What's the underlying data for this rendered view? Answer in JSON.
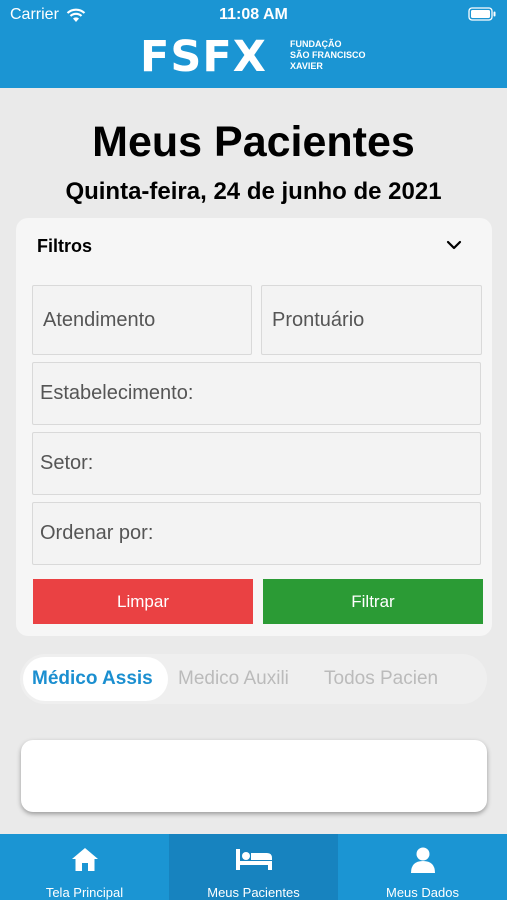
{
  "status_bar": {
    "carrier": "Carrier",
    "time": "11:08 AM"
  },
  "brand": {
    "mark": "FSFX",
    "sub_line1": "FUNDAÇÃO",
    "sub_line2": "SÃO FRANCISCO",
    "sub_line3": "XAVIER"
  },
  "page": {
    "title": "Meus Pacientes",
    "date": "Quinta-feira, 24 de junho de 2021"
  },
  "filters": {
    "title": "Filtros",
    "atendimento_placeholder": "Atendimento",
    "prontuario_placeholder": "Prontuário",
    "estabelecimento_label": "Estabelecimento:",
    "setor_label": "Setor:",
    "ordenar_label": "Ordenar por:",
    "clear_label": "Limpar",
    "filter_label": "Filtrar"
  },
  "segment_tabs": [
    {
      "label": "Médico Assis",
      "active": true
    },
    {
      "label": "Medico Auxili",
      "active": false
    },
    {
      "label": "Todos Pacien",
      "active": false
    }
  ],
  "tab_bar": [
    {
      "label": "Tela Principal",
      "icon": "home-icon",
      "active": false
    },
    {
      "label": "Meus Pacientes",
      "icon": "bed-icon",
      "active": true
    },
    {
      "label": "Meus Dados",
      "icon": "user-icon",
      "active": false
    }
  ],
  "colors": {
    "brand_blue": "#1b95d3",
    "active_tab_blue": "#1b8fd0",
    "clear_red": "#ea4143",
    "filter_green": "#2b9b35"
  }
}
